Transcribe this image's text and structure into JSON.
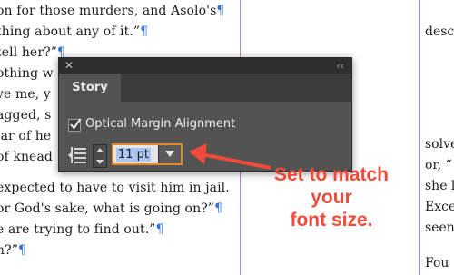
{
  "document": {
    "left_lines": [
      {
        "text": "on for those murders, and Asolo's",
        "mark": "¶"
      },
      {
        "text": "thing about any of it.”",
        "mark": "¶"
      },
      {
        "text": "tell her?”",
        "mark": "¶"
      },
      {
        "text": "othing w",
        "mark": ""
      },
      {
        "text": "ve me, y",
        "mark": ""
      },
      {
        "text": "agged, s",
        "mark": ""
      },
      {
        "text": "lar of he",
        "mark": ""
      },
      {
        "text": "of knead",
        "mark": ""
      },
      {
        "text": "expected to have to visit him in jail.",
        "mark": ""
      },
      {
        "text": "or God's sake, what is going on?”",
        "mark": "¶"
      },
      {
        "text": "e are trying to find out.”",
        "mark": "¶"
      },
      {
        "text": "n?”",
        "mark": "¶"
      }
    ],
    "right_lines": [
      "desc",
      "",
      "",
      "",
      "",
      "",
      "solve",
      "or, “",
      "she l",
      "Exce",
      "seen",
      "",
      "Fou"
    ]
  },
  "panel": {
    "close_glyph": "✕",
    "collapse_glyph": "‹‹",
    "tab_label": "Story",
    "optical_margin_label": "Optical Margin Alignment",
    "optical_margin_checked": true,
    "font_size_value": "11 pt",
    "icons": [
      "close-icon",
      "collapse-icon",
      "checkmark-icon",
      "margin-alignment-icon",
      "stepper-up-icon",
      "stepper-down-icon",
      "dropdown-arrow-icon"
    ]
  },
  "annotation": {
    "lines": [
      "Set to match",
      "your",
      "font size."
    ],
    "color": "#ef4a3a"
  },
  "colors": {
    "panel_bg": "#535353",
    "panel_titlebar": "#2e2e2e",
    "highlight_border": "#e08a2a",
    "selection": "#a9c6f2",
    "pilcrow": "#2f6fde",
    "guide": "#a98bd7"
  }
}
